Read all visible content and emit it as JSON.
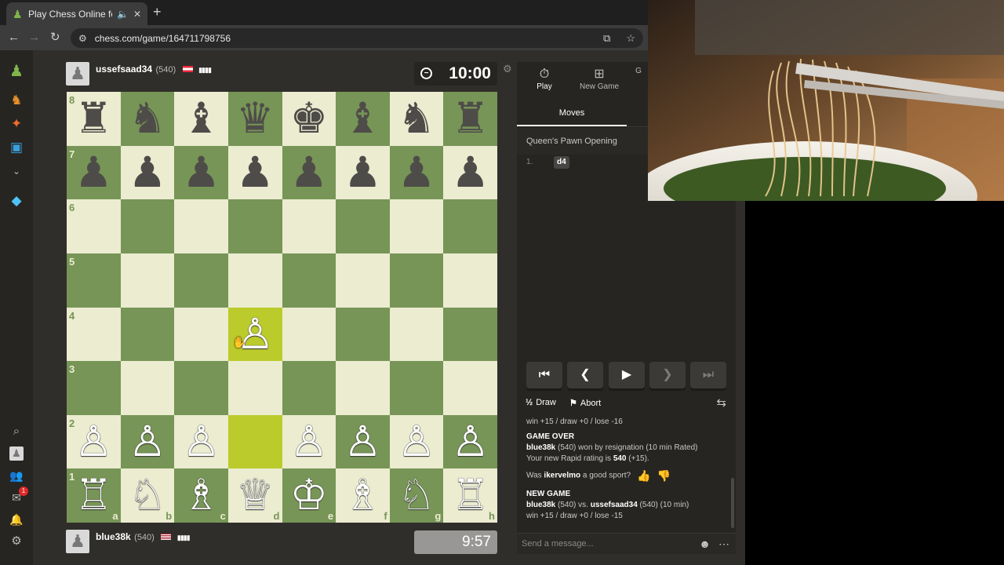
{
  "browser": {
    "tab_title": "Play Chess Online for FREE",
    "tab_audio_icon": "speaker-icon",
    "url": "chess.com/game/164711798756",
    "new_tab_label": "+"
  },
  "sidebar": {
    "icons": [
      "pawn-logo-icon",
      "play-icon",
      "puzzles-icon",
      "learn-icon",
      "more-chevron-icon",
      "diamond-icon",
      "search-icon",
      "profile-icon",
      "friends-icon",
      "messages-icon",
      "notifications-icon",
      "settings-icon"
    ],
    "messages_badge": "1"
  },
  "top_player": {
    "name": "ussefsaad34",
    "rating": "(540)",
    "flag": "austria"
  },
  "bottom_player": {
    "name": "blue38k",
    "rating": "(540)",
    "flag": "usa"
  },
  "clocks": {
    "top": "10:00",
    "bottom": "9:57"
  },
  "board": {
    "ranks": [
      "8",
      "7",
      "6",
      "5",
      "4",
      "3",
      "2",
      "1"
    ],
    "files": [
      "a",
      "b",
      "c",
      "d",
      "e",
      "f",
      "g",
      "h"
    ],
    "position": [
      [
        "♜",
        "♞",
        "♝",
        "♛",
        "♚",
        "♝",
        "♞",
        "♜"
      ],
      [
        "♟",
        "♟",
        "♟",
        "♟",
        "♟",
        "♟",
        "♟",
        "♟"
      ],
      [
        "",
        "",
        "",
        "",
        "",
        "",
        "",
        ""
      ],
      [
        "",
        "",
        "",
        "",
        "",
        "",
        "",
        ""
      ],
      [
        "",
        "",
        "",
        "♙",
        "",
        "",
        "",
        ""
      ],
      [
        "",
        "",
        "",
        "",
        "",
        "",
        "",
        ""
      ],
      [
        "♙",
        "♙",
        "♙",
        "",
        "♙",
        "♙",
        "♙",
        "♙"
      ],
      [
        "♖",
        "♘",
        "♗",
        "♕",
        "♔",
        "♗",
        "♘",
        "♖"
      ]
    ],
    "last_move_squares": [
      "d2",
      "d4"
    ]
  },
  "panel": {
    "tabs": [
      {
        "icon": "stopwatch-icon",
        "label": "Play"
      },
      {
        "icon": "plus-square-icon",
        "label": "New Game"
      },
      {
        "icon": "",
        "label": "G"
      }
    ],
    "moves_header": "Moves",
    "opening": "Queen's Pawn Opening",
    "moves": [
      {
        "number": "1.",
        "white": "d4"
      }
    ],
    "controls": [
      "first-move-button",
      "previous-move-button",
      "play-button",
      "next-move-button",
      "last-move-button"
    ],
    "draw_icon": "½",
    "draw_label": "Draw",
    "abort_label": "Abort",
    "chat": {
      "line1": "win +15 / draw +0 / lose -16",
      "game_over": "GAME OVER",
      "result_player": "blue38k",
      "result_text": "(540) won by resignation (10 min Rated)",
      "rating_prefix": "Your new Rapid rating is ",
      "rating_value": "540",
      "rating_suffix": "(+15).",
      "sport_prefix": "Was ",
      "sport_player": "ikervelmo",
      "sport_suffix": " a good sport?",
      "new_game": "NEW GAME",
      "ng_white": "blue38k",
      "ng_white_rating": "(540) vs.",
      "ng_black": "ussefsaad34",
      "ng_black_rating": "(540) (10 min)",
      "line_last": "win +15 / draw +0 / lose -15"
    },
    "chat_placeholder": "Send a message..."
  }
}
